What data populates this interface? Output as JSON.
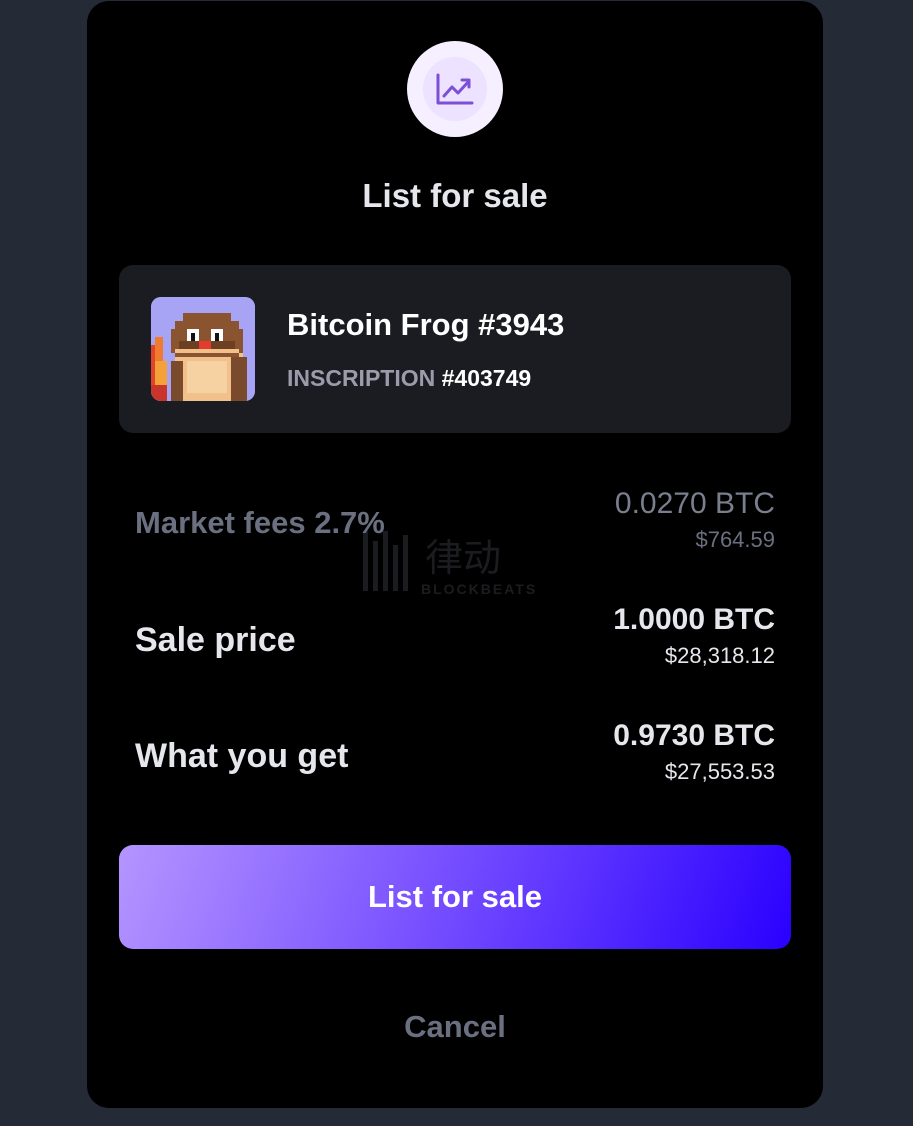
{
  "dialog": {
    "icon": "trending-up-icon",
    "title": "List for sale"
  },
  "item": {
    "name": "Bitcoin Frog #3943",
    "inscription_label": "INSCRIPTION",
    "inscription_number": "#403749",
    "image": "bitcoin-frog-pixel-art"
  },
  "fees": {
    "label": "Market fees 2.7%",
    "btc": "0.0270 BTC",
    "usd": "$764.59"
  },
  "sale_price": {
    "label": "Sale price",
    "btc": "1.0000 BTC",
    "usd": "$28,318.12"
  },
  "what_you_get": {
    "label": "What you get",
    "btc": "0.9730 BTC",
    "usd": "$27,553.53"
  },
  "actions": {
    "primary_label": "List for sale",
    "cancel_label": "Cancel"
  },
  "watermark": {
    "text": "BLOCKBEATS",
    "chinese": "律动"
  },
  "colors": {
    "background": "#252a37",
    "modal": "#000000",
    "card": "#1b1c22",
    "accent_start": "#b495ff",
    "accent_end": "#2a00ff",
    "icon_purple": "#7b4fd6"
  }
}
